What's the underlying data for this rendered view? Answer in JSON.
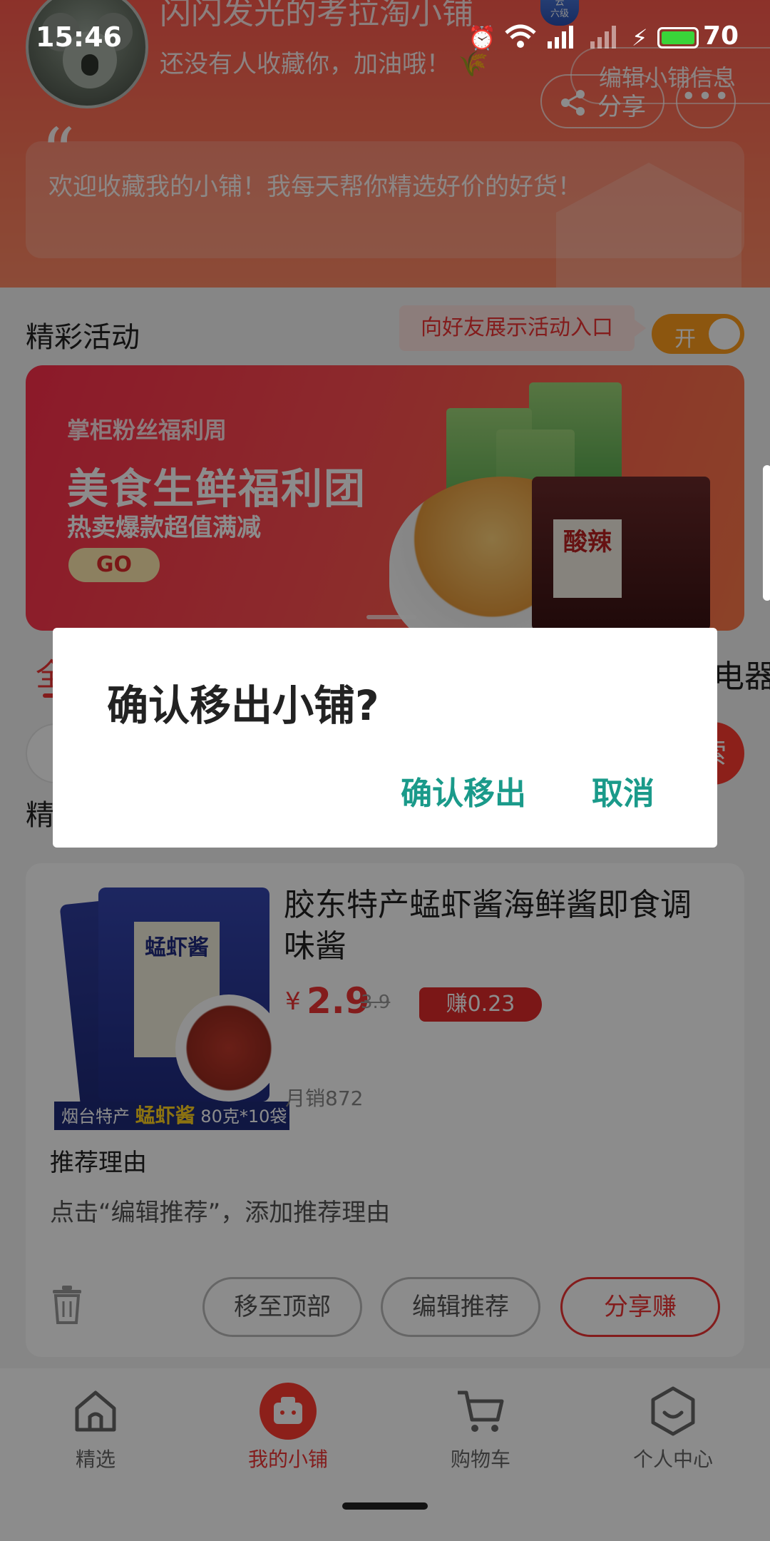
{
  "status_bar": {
    "time": "15:46",
    "battery": "70"
  },
  "header": {
    "shop_name": "闪闪发光的考拉淘小铺",
    "subtitle": "还没有人收藏你，加油哦！",
    "edit_link": "编辑小铺信息",
    "share_label": "分享",
    "more_label": "•••",
    "intro": "欢迎收藏我的小铺！我每天帮你精选好价的好货！"
  },
  "activities": {
    "title": "精彩活动",
    "tooltip": "向好友展示活动入口",
    "toggle_label": "开",
    "banner": {
      "line1": "掌柜粉丝福利周",
      "line2": "美食生鲜福利团",
      "line3": "热卖爆款超值满减",
      "go": "GO",
      "pack_label": "酸辣"
    }
  },
  "categories": {
    "left_partial": "全",
    "right_partial": "电器"
  },
  "section2_partial": "精",
  "search_btn_partial": "索",
  "product": {
    "title": "胶东特产蜢虾酱海鲜酱即食调味酱",
    "price_symbol": "¥",
    "price": "2.9",
    "original_price": "3.9",
    "earn": "赚0.23",
    "monthly_sales": "月销872",
    "image_label": "蜢虾酱",
    "image_strip_prefix": "烟台特产",
    "image_strip_highlight": "蜢虾酱",
    "image_strip_suffix": "80克*10袋",
    "reason_title": "推荐理由",
    "reason_text": "点击“编辑推荐”，添加推荐理由",
    "btn_move_top": "移至顶部",
    "btn_edit": "编辑推荐",
    "btn_share": "分享赚"
  },
  "tabbar": {
    "items": [
      {
        "label": "精选",
        "icon": "home-icon"
      },
      {
        "label": "我的小铺",
        "icon": "shop-icon"
      },
      {
        "label": "购物车",
        "icon": "cart-icon"
      },
      {
        "label": "个人中心",
        "icon": "profile-icon"
      }
    ]
  },
  "dialog": {
    "title": "确认移出小铺?",
    "confirm": "确认移出",
    "cancel": "取消"
  },
  "colors": {
    "accent": "#ff3b30",
    "dialog_button": "#1a9a8a",
    "toggle": "#ff9d1c"
  }
}
